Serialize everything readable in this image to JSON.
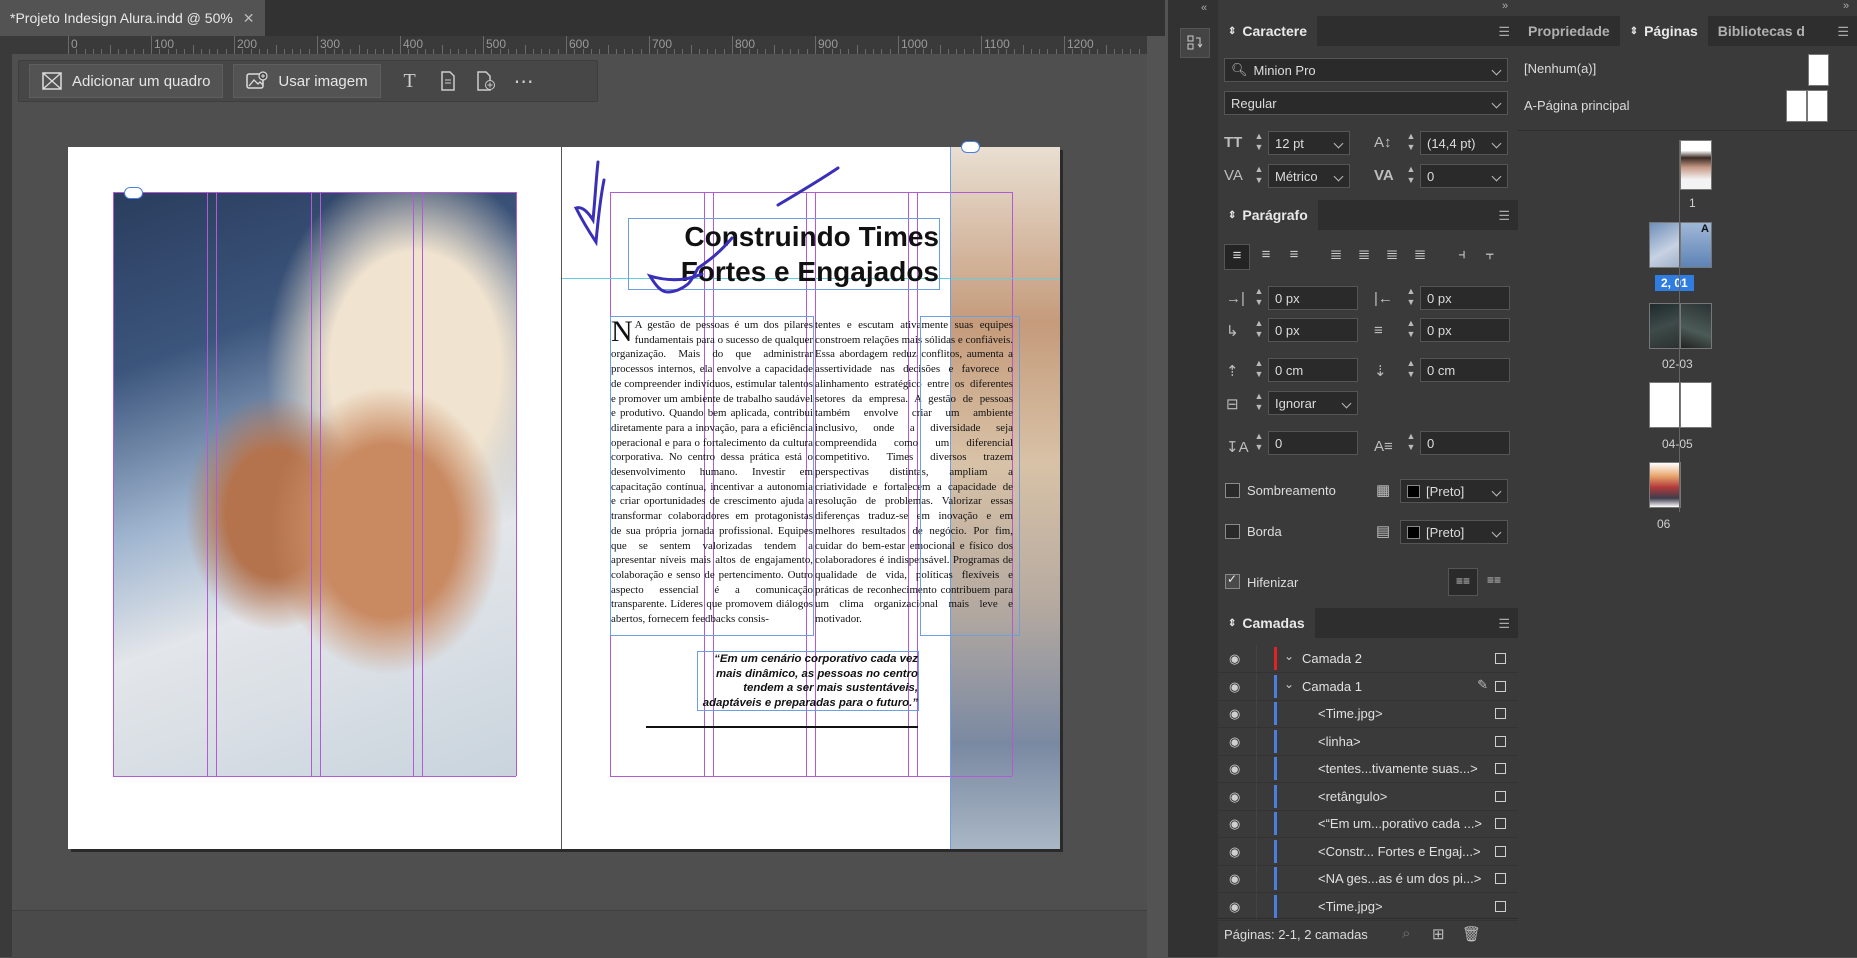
{
  "document": {
    "tab_title": "*Projeto Indesign Alura.indd @ 50%",
    "close_glyph": "✕"
  },
  "ruler": {
    "labels": [
      "0",
      "100",
      "200",
      "300",
      "400",
      "500",
      "600",
      "700",
      "800",
      "900",
      "1000",
      "1100",
      "1200"
    ]
  },
  "context_toolbar": {
    "add_frame_label": "Adicionar um quadro",
    "use_image_label": "Usar imagem"
  },
  "page_content": {
    "heading_line1": "Construindo Times",
    "heading_line2": "Fortes e Engajados",
    "dropcap": "N",
    "col1_text": "A gestão de pessoas é um dos pilares fundamentais para o sucesso de qualquer organização. Mais do que administrar processos internos, ela envolve a capacidade de compreender indivíduos, estimular talentos e promover um ambiente de trabalho saudável e produtivo. Quando bem aplicada, contribui diretamente para a inovação, para a eficiência operacional e para o fortalecimento da cultura corporativa. No centro dessa prática está o desenvolvimento humano. Investir em capacitação contínua, incentivar a autonomia e criar oportunidades de crescimento ajuda a transformar colaboradores em protagonistas de sua própria jornada profissional. Equipes que se sentem valorizadas tendem a apresentar níveis mais altos de engajamento, colaboração e senso de pertencimento. Outro aspecto essencial é a comunicação transparente. Líderes que promovem diálogos abertos, fornecem feedbacks consis-",
    "col2_text": "tentes e escutam ativamente suas equipes constroem relações mais sólidas e confiáveis. Essa abordagem reduz conflitos, aumenta a assertividade nas decisões e favorece o alinhamento estratégico entre os diferentes setores da empresa. A gestão de pessoas também envolve criar um ambiente inclusivo, onde a diversidade seja compreendida como um diferencial competitivo. Times diversos trazem perspectivas distintas, ampliam a criatividade e fortalecem a capacidade de resolução de problemas. Valorizar essas diferenças traduz-se em inovação e em melhores resultados de negócio. Por fim, cuidar do bem-estar emocional e físico dos colaboradores é indispensável. Programas de qualidade de vida, políticas flexíveis e práticas de reconhecimento contribuem para um clima organizacional mais leve e motivador.",
    "quote": "“Em um cenário corporativo cada vez mais dinâmico, as pessoas no centro tendem a ser mais sustentáveis, adaptáveis e preparadas para o futuro.”"
  },
  "caractere": {
    "title": "Caractere",
    "font_family": "Minion Pro",
    "font_style": "Regular",
    "size": "12 pt",
    "leading": "(14,4 pt)",
    "kerning": "Métrico",
    "tracking": "0"
  },
  "paragrafo": {
    "title": "Parágrafo",
    "left_indent": "0 px",
    "right_indent": "0 px",
    "first_line_indent": "0 px",
    "last_line_indent": "0 px",
    "space_before": "0 cm",
    "space_after": "0 cm",
    "align_to_grid": "Ignorar",
    "drop_cap_lines": "0",
    "drop_cap_chars": "0",
    "shading_label": "Sombreamento",
    "shading_color": "[Preto]",
    "border_label": "Borda",
    "border_color": "[Preto]",
    "hyphenate_label": "Hifenizar"
  },
  "camadas": {
    "title": "Camadas",
    "layers": [
      {
        "name": "Camada 2",
        "color": "#e02424",
        "indent": 0
      },
      {
        "name": "Camada 1",
        "color": "#4a7fe0",
        "indent": 0
      },
      {
        "name": "<Time.jpg>",
        "color": "#4a7fe0",
        "indent": 1
      },
      {
        "name": "<linha>",
        "color": "#4a7fe0",
        "indent": 1
      },
      {
        "name": "<tentes...tivamente suas...>",
        "color": "#4a7fe0",
        "indent": 1
      },
      {
        "name": "<retângulo>",
        "color": "#4a7fe0",
        "indent": 1
      },
      {
        "name": "<“Em um...porativo cada ...>",
        "color": "#4a7fe0",
        "indent": 1
      },
      {
        "name": "<Constr... Fortes e Engaj...>",
        "color": "#4a7fe0",
        "indent": 1
      },
      {
        "name": "<NA ges...as é um dos pi...>",
        "color": "#4a7fe0",
        "indent": 1
      },
      {
        "name": "<Time.jpg>",
        "color": "#4a7fe0",
        "indent": 1
      }
    ],
    "status": "Páginas: 2-1, 2 camadas"
  },
  "paginas": {
    "tabs": [
      "Propriedade",
      "Páginas",
      "Bibliotecas d"
    ],
    "none_label": "[Nenhum(a)]",
    "master_label": "A-Página principal",
    "page_labels": [
      "1",
      "2, 01",
      "02-03",
      "04-05",
      "06"
    ],
    "master_marker": "A"
  },
  "colors": {
    "selection_blue": "#2f7de0",
    "guide_magenta": "#b15bd6",
    "layer_red": "#e02424"
  }
}
